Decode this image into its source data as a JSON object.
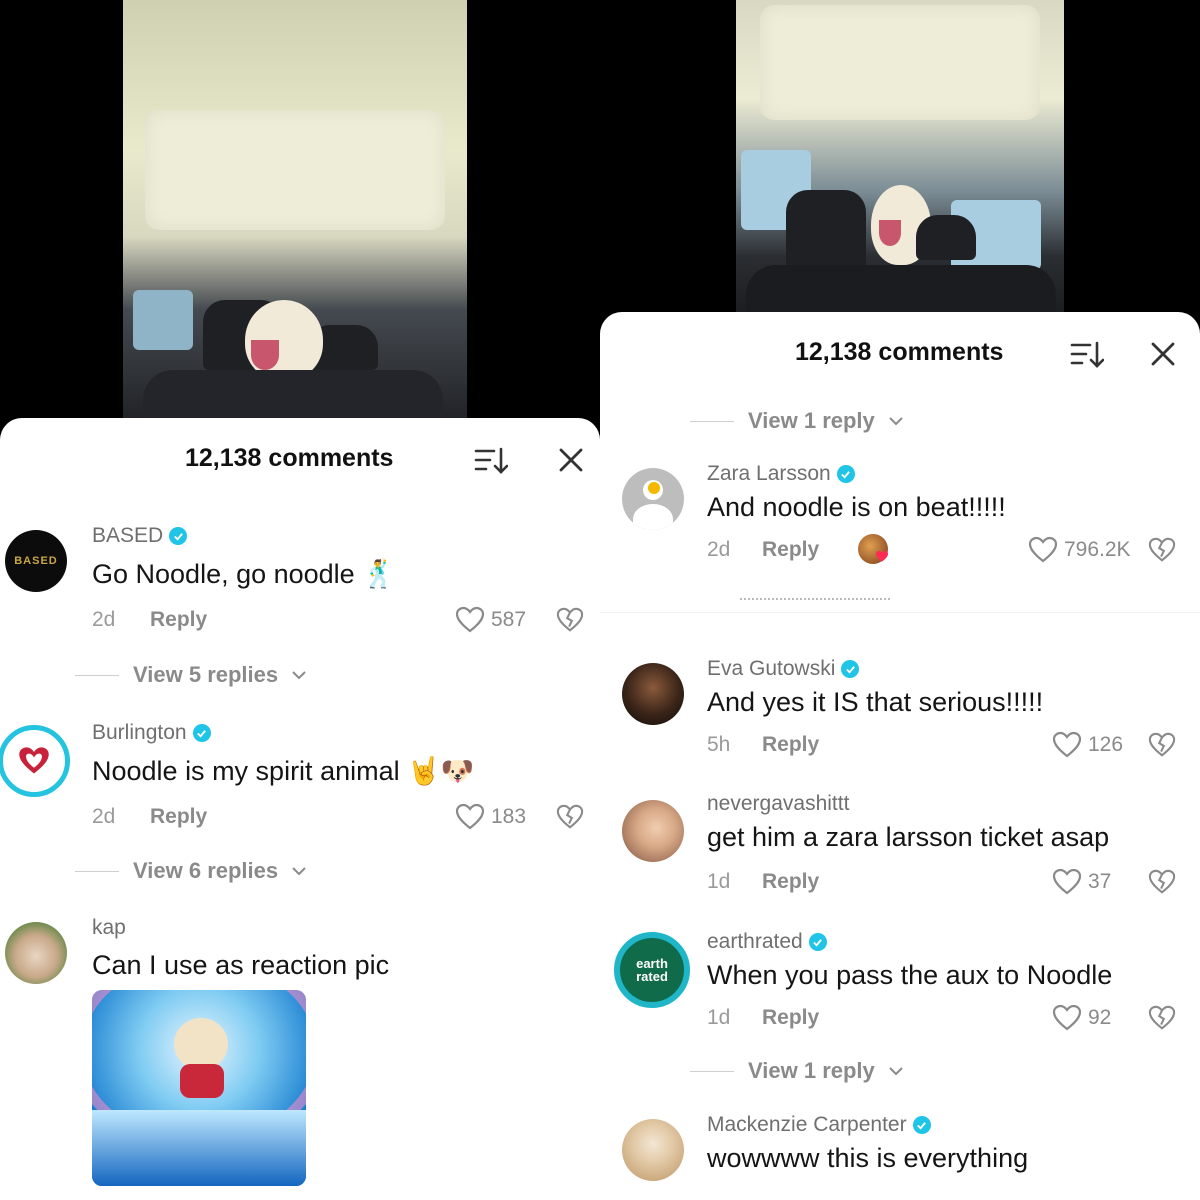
{
  "left": {
    "header": {
      "title": "12,138 comments"
    },
    "comments": [
      {
        "username": "BASED",
        "verified": true,
        "avatar_text": "BASED",
        "text": "Go Noodle, go noodle 🕺",
        "time": "2d",
        "reply_label": "Reply",
        "likes": "587"
      },
      {
        "view_replies": "View 5 replies"
      },
      {
        "username": "Burlington",
        "verified": true,
        "text": "Noodle is my spirit animal 🤘🐶",
        "time": "2d",
        "reply_label": "Reply",
        "likes": "183"
      },
      {
        "view_replies": "View 6 replies"
      },
      {
        "username": "kap",
        "verified": false,
        "text": "Can I use as reaction pic"
      }
    ]
  },
  "right": {
    "header": {
      "title": "12,138 comments"
    },
    "top_view_replies": "View 1 reply",
    "comments": [
      {
        "username": "Zara Larsson",
        "verified": true,
        "text": "And noodle is on beat!!!!!",
        "time": "2d",
        "reply_label": "Reply",
        "likes": "796.2K"
      },
      {
        "username": "Eva Gutowski",
        "verified": true,
        "text": "And yes it IS that serious!!!!!",
        "time": "5h",
        "reply_label": "Reply",
        "likes": "126"
      },
      {
        "username": "nevergavashittt",
        "verified": false,
        "text": "get him a zara larsson ticket asap",
        "time": "1d",
        "reply_label": "Reply",
        "likes": "37"
      },
      {
        "username": "earthrated",
        "verified": true,
        "avatar_text": "earth rated",
        "text": "When you pass the aux to Noodle",
        "time": "1d",
        "reply_label": "Reply",
        "likes": "92"
      },
      {
        "view_replies": "View 1 reply"
      },
      {
        "username": "Mackenzie Carpenter",
        "verified": true,
        "text": "wowwww this is everything"
      }
    ]
  },
  "icons": {
    "sort": "sort-icon",
    "close": "close-icon",
    "like": "heart-outline-icon",
    "dislike": "broken-heart-icon",
    "verified": "verified-check-icon",
    "chevron": "chevron-down-icon"
  },
  "colors": {
    "verified": "#20c4e6",
    "muted": "#8a8a8a",
    "text": "#151515"
  }
}
